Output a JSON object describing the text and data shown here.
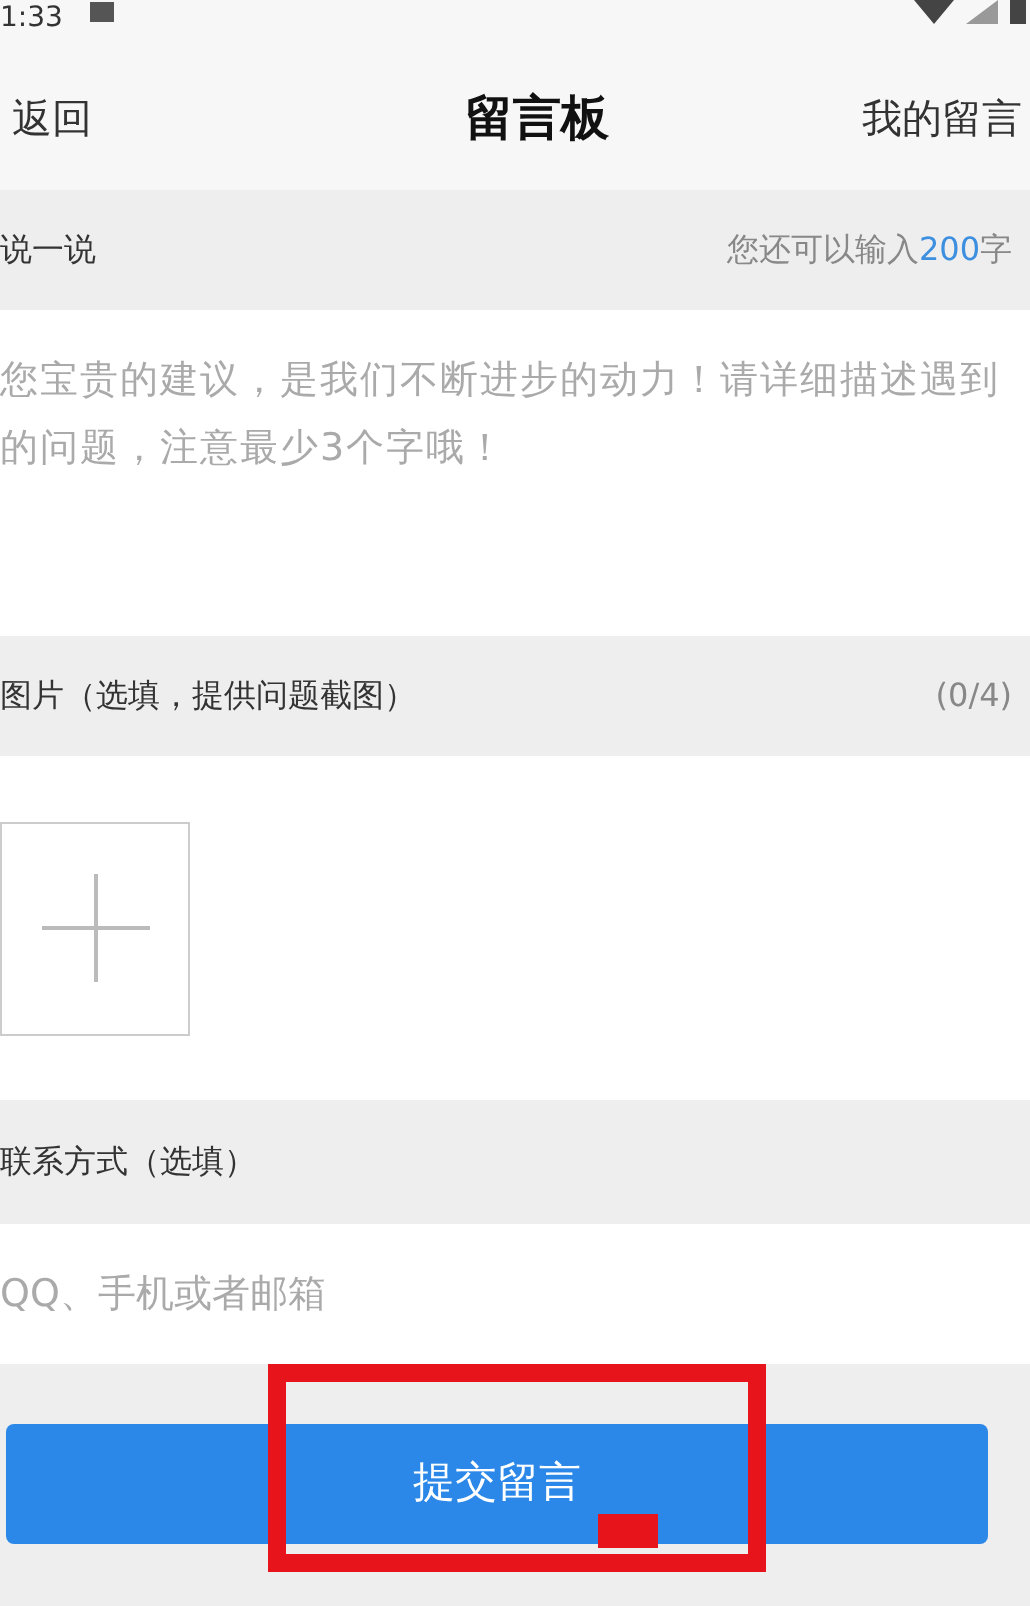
{
  "status_bar": {
    "time": "1:33"
  },
  "header": {
    "back": "返回",
    "title": "留言板",
    "action": "我的留言"
  },
  "message": {
    "label": "说一说",
    "counter_prefix": "您还可以输入",
    "counter_value": "200",
    "counter_suffix": "字",
    "placeholder": "您宝贵的建议，是我们不断进步的动力！请详细描述遇到的问题，注意最少3个字哦！"
  },
  "images": {
    "label": "图片（选填，提供问题截图）",
    "count": "(0/4)"
  },
  "contact": {
    "label": "联系方式（选填）",
    "placeholder": "QQ、手机或者邮箱"
  },
  "submit": {
    "label": "提交留言",
    "highlighted": true
  }
}
